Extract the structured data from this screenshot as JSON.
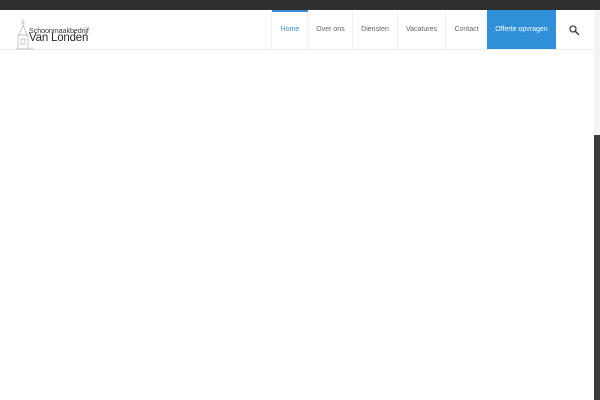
{
  "logo": {
    "line1": "Schoonmaakbedrijf",
    "line2": "Van Londen"
  },
  "nav": {
    "items": [
      "Home",
      "Over ons",
      "Diensten",
      "Vacatures",
      "Contact"
    ],
    "cta": "Offerte opvragen",
    "active_index": 0
  },
  "colors": {
    "accent": "#3a8fd6",
    "cta_background": "#2f8fd8",
    "topbar": "#2f2f2f",
    "scroll_thumb": "#3c3c3c"
  },
  "icons": {
    "search": "search-icon",
    "logo": "church-tower-icon"
  }
}
